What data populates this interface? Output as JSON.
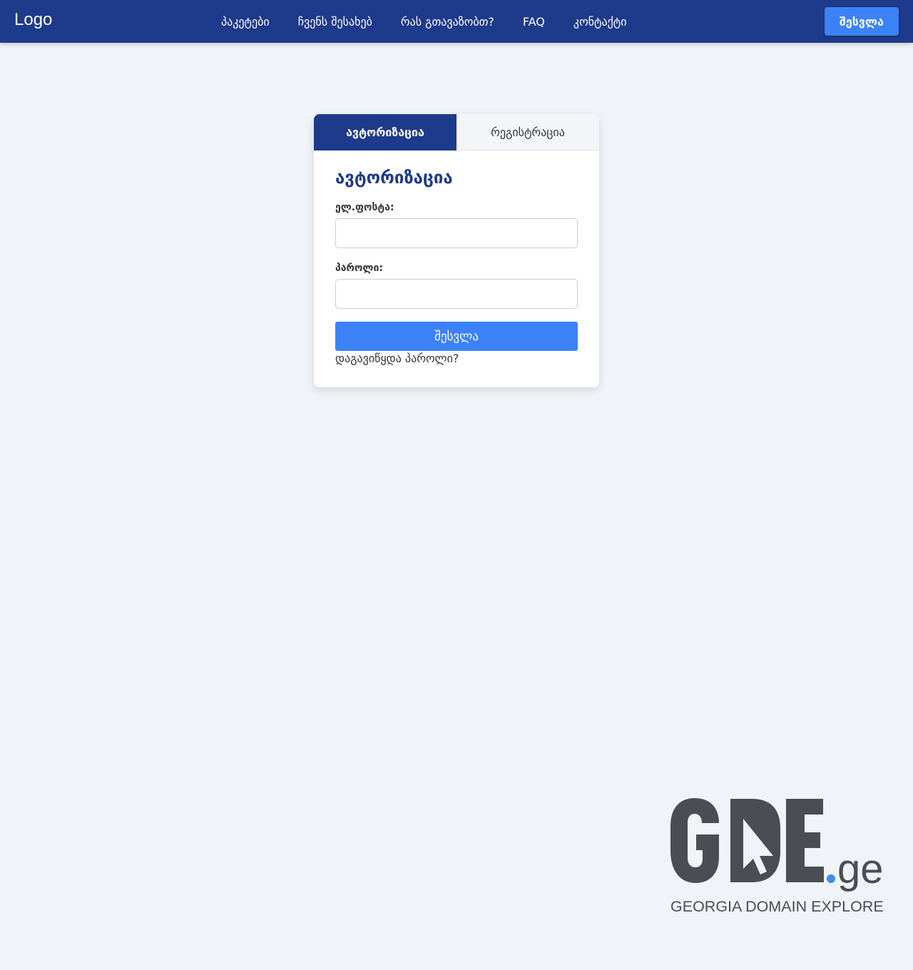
{
  "nav": {
    "logo": "Logo",
    "links": [
      "პაკეტები",
      "ჩვენს შესახებ",
      "რას გთავაზობთ?",
      "FAQ",
      "კონტაქტი"
    ],
    "login_button": "შესვლა"
  },
  "tabs": {
    "login": "ავტორიზაცია",
    "register": "რეგისტრაცია"
  },
  "form": {
    "title": "ავტორიზაცია",
    "email_label": "ელ.ფოსტა:",
    "email_value": "",
    "password_label": "პაროლი:",
    "password_value": "",
    "submit": "შესვლა",
    "forgot": "დაგავიწყდა პაროლი?"
  },
  "brand": {
    "logo_name": "GDE.ge",
    "tagline": "GEORGIA DOMAIN EXPLORER",
    "colors": {
      "main": "#4a4d52",
      "dot": "#3b8ef3"
    }
  },
  "colors": {
    "navbar": "#1e3a8a",
    "accent": "#3b82f6",
    "background": "#f0f4f8"
  }
}
